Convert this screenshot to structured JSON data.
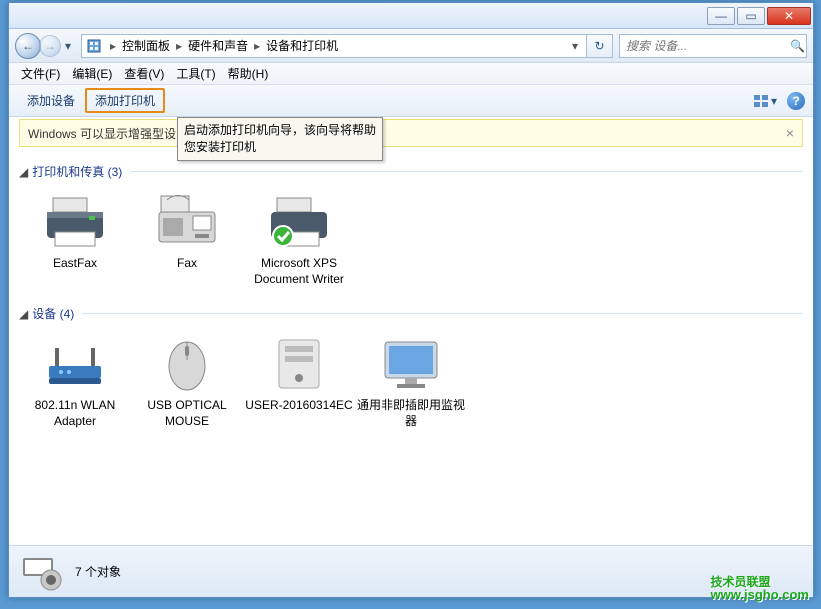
{
  "titlebar": {
    "minimize": "—",
    "maximize": "▭",
    "close": "✕"
  },
  "nav": {
    "back_arrow": "←",
    "fwd_arrow": "→",
    "dropdown": "▾"
  },
  "address": {
    "crumbs": [
      "控制面板",
      "硬件和声音",
      "设备和打印机"
    ],
    "sep": "▸",
    "down": "▾",
    "refresh": "↻"
  },
  "search": {
    "placeholder": "搜索 设备...",
    "icon": "🔍"
  },
  "menu": {
    "items": [
      "文件(F)",
      "编辑(E)",
      "查看(V)",
      "工具(T)",
      "帮助(H)"
    ]
  },
  "toolbar": {
    "add_device": "添加设备",
    "add_printer": "添加打印机",
    "view_dropdown": "▾",
    "help": "?"
  },
  "tooltip": {
    "text": "启动添加打印机向导，该向导将帮助您安装打印机"
  },
  "infobar": {
    "text": "Windows 可以显示增强型设                                                    i进行更改...",
    "close": "×"
  },
  "groups": [
    {
      "title": "打印机和传真 (3)",
      "items": [
        {
          "label": "EastFax",
          "svg": "printer"
        },
        {
          "label": "Fax",
          "svg": "fax"
        },
        {
          "label": "Microsoft XPS Document Writer",
          "svg": "printer-check"
        }
      ]
    },
    {
      "title": "设备 (4)",
      "items": [
        {
          "label": "802.11n WLAN Adapter",
          "svg": "wlan"
        },
        {
          "label": "USB OPTICAL MOUSE",
          "svg": "mouse"
        },
        {
          "label": "USER-20160314EC",
          "svg": "computer"
        },
        {
          "label": "通用非即插即用监视器",
          "svg": "monitor"
        }
      ]
    }
  ],
  "status": {
    "text": "7 个对象"
  },
  "watermark": {
    "title": "技术员联盟",
    "url": "www.jsgho.com"
  }
}
